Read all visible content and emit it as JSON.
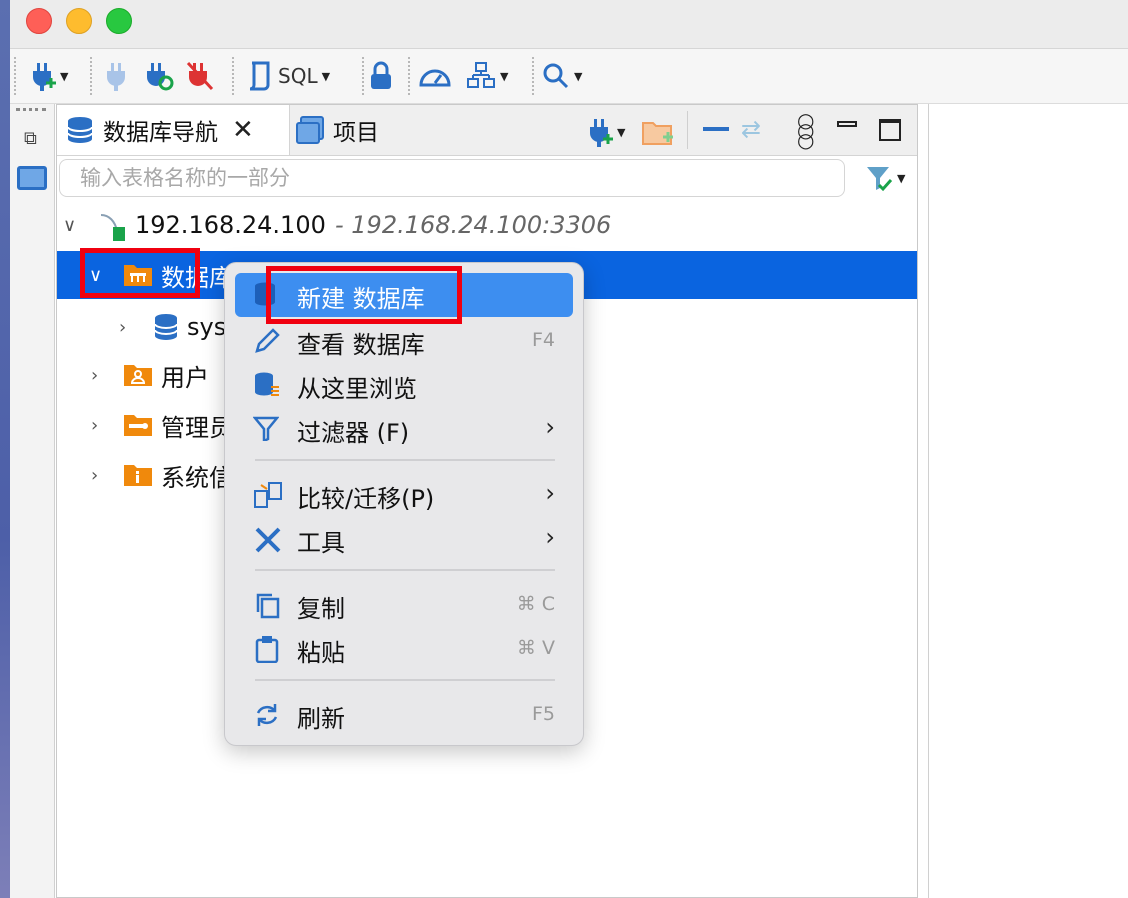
{
  "toolbar": {
    "sql_label": "SQL"
  },
  "navigator": {
    "tabs": [
      {
        "label": "数据库导航"
      },
      {
        "label": "项目"
      }
    ],
    "search_placeholder": "输入表格名称的一部分"
  },
  "tree": {
    "connection": {
      "name": "192.168.24.100",
      "detail": "- 192.168.24.100:3306"
    },
    "items": [
      {
        "label": "数据库"
      },
      {
        "label": "sys"
      },
      {
        "label": "用户"
      },
      {
        "label": "管理员"
      },
      {
        "label": "系统信息"
      }
    ]
  },
  "context_menu": {
    "items": [
      {
        "label": "新建 数据库",
        "shortcut": ""
      },
      {
        "label": "查看 数据库",
        "shortcut": "F4"
      },
      {
        "label": "从这里浏览",
        "shortcut": ""
      },
      {
        "label": "过滤器 (F)",
        "shortcut": ""
      },
      {
        "label": "比较/迁移(P)",
        "shortcut": ""
      },
      {
        "label": "工具",
        "shortcut": ""
      },
      {
        "label": "复制",
        "shortcut": "⌘ C"
      },
      {
        "label": "粘贴",
        "shortcut": "⌘ V"
      },
      {
        "label": "刷新",
        "shortcut": "F5"
      }
    ]
  },
  "colors": {
    "selection": "#0a64e0",
    "menu_highlight": "#3d8ef0",
    "annotation": "#f00010",
    "folder": "#f0890c"
  }
}
